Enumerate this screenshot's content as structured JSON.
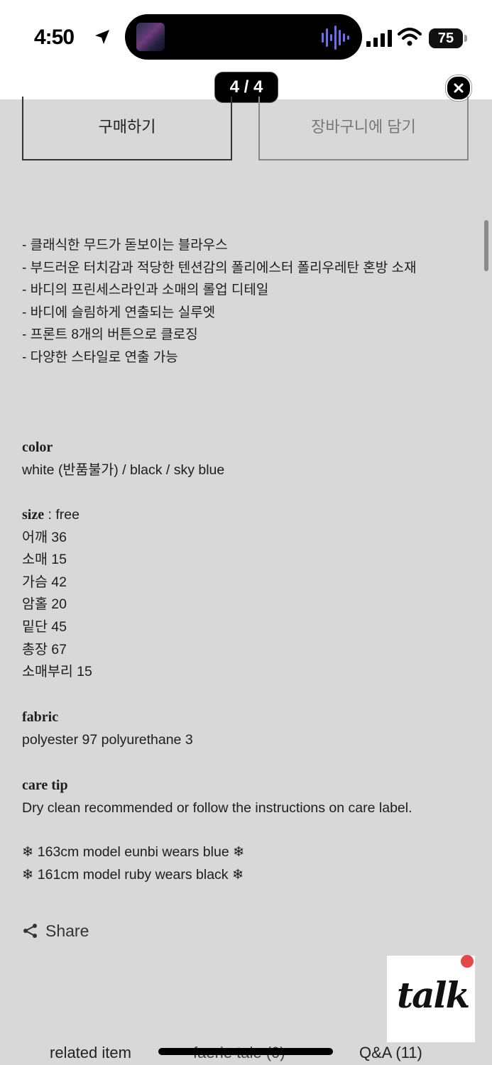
{
  "status_bar": {
    "time": "4:50",
    "battery": "75"
  },
  "viewer": {
    "page_counter": "4 / 4"
  },
  "actions": {
    "buy_label": "구매하기",
    "cart_label": "장바구니에 담기"
  },
  "description": {
    "bullets": [
      "- 클래식한 무드가 돋보이는 블라우스",
      "- 부드러운 터치감과 적당한 텐션감의 폴리에스터 폴리우레탄 혼방 소재",
      "- 바디의 프린세스라인과 소매의 롤업 디테일",
      "- 바디에 슬림하게 연출되는 실루엣",
      "- 프론트 8개의 버튼으로 클로징",
      "- 다양한 스타일로 연출 가능"
    ]
  },
  "details": {
    "color_heading": "color",
    "color_value": "white (반품불가) / black / sky blue",
    "size_heading": "size",
    "size_value": " : free",
    "size_rows": [
      "어깨 36",
      "소매 15",
      "가슴 42",
      "암홀 20",
      "밑단 45",
      "총장 67",
      "소매부리 15"
    ],
    "fabric_heading": "fabric",
    "fabric_value": "polyester 97 polyurethane 3",
    "care_heading": "care tip",
    "care_value": "Dry clean recommended or follow the instructions on care label.",
    "models": [
      "❄ 163cm model eunbi wears blue ❄",
      "❄ 161cm model ruby wears black ❄"
    ]
  },
  "share": {
    "label": "Share"
  },
  "talk": {
    "label": "talk"
  },
  "bottom_tabs": {
    "related": "related item",
    "middle": "faerie tale (0)",
    "qa": "Q&A (11)"
  },
  "colors": {
    "background": "#d8d8d8",
    "notification_dot": "#e2484a"
  }
}
